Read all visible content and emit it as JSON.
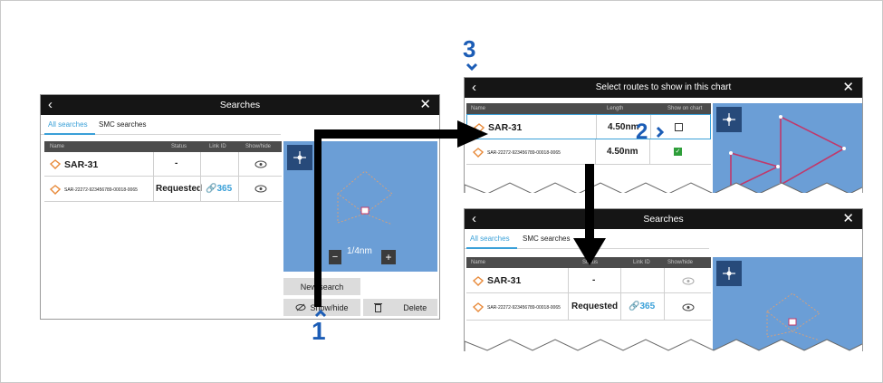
{
  "searches_panel": {
    "title": "Searches",
    "tabs": [
      "All searches",
      "SMC searches"
    ],
    "columns": [
      "Name",
      "Status",
      "Link ID",
      "Show/hide"
    ],
    "rows": [
      {
        "name": "SAR-31",
        "status": "-",
        "link_id": ""
      },
      {
        "name": "SAR-22272-923456789-00018-0065",
        "status": "Requested",
        "link_id": "365"
      }
    ],
    "scale_label": "1/4nm",
    "buttons": {
      "new_search": "New search",
      "show_hide": "Show/hide",
      "delete": "Delete"
    }
  },
  "select_routes_panel": {
    "title": "Select routes to show in this chart",
    "columns": [
      "Name",
      "Length",
      "Show on chart"
    ],
    "rows": [
      {
        "name": "SAR-31",
        "length": "4.50nm",
        "checked": false
      },
      {
        "name": "SAR-22272-923456789-00018-0065",
        "length": "4.50nm",
        "checked": true
      }
    ]
  },
  "searches_panel_result": {
    "title": "Searches",
    "tabs": [
      "All searches",
      "SMC searches"
    ],
    "columns": [
      "Name",
      "Status",
      "Link ID",
      "Show/hide"
    ],
    "rows": [
      {
        "name": "SAR-31",
        "status": "-",
        "link_id": ""
      },
      {
        "name": "SAR-22272-923456789-00018-0065",
        "status": "Requested",
        "link_id": "365"
      }
    ]
  },
  "callouts": {
    "step1": "1",
    "step2": "2",
    "step3": "3"
  },
  "colors": {
    "accent": "#3aa0d8",
    "map": "#6b9ed6",
    "route": "#c0396b",
    "callout": "#1c5db6",
    "titlebar": "#151515"
  }
}
